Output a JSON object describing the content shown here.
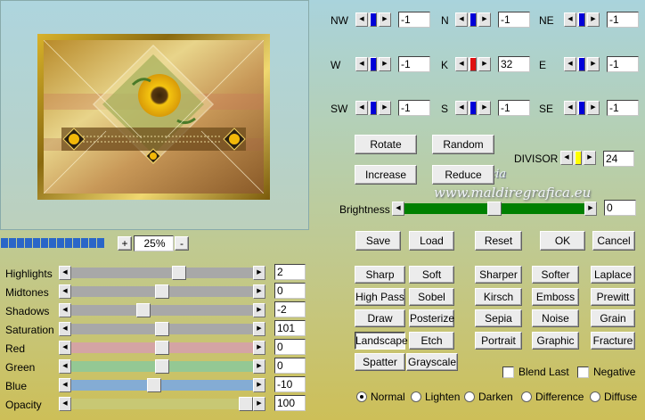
{
  "preview": {
    "zoom_value": "25%",
    "zoom_plus": "+",
    "zoom_minus": "-",
    "progress_segments": 13
  },
  "watermark": {
    "line1": "Pinuccia",
    "line2": "www.maldiregrafica.eu"
  },
  "matrix": [
    {
      "label": "NW",
      "value": "-1",
      "color": "#0000d8"
    },
    {
      "label": "N",
      "value": "-1",
      "color": "#0000d8"
    },
    {
      "label": "NE",
      "value": "-1",
      "color": "#0000d8"
    },
    {
      "label": "W",
      "value": "-1",
      "color": "#0000d8"
    },
    {
      "label": "K",
      "value": "32",
      "color": "#e01010"
    },
    {
      "label": "E",
      "value": "-1",
      "color": "#0000d8"
    },
    {
      "label": "SW",
      "value": "-1",
      "color": "#0000d8"
    },
    {
      "label": "S",
      "value": "-1",
      "color": "#0000d8"
    },
    {
      "label": "SE",
      "value": "-1",
      "color": "#0000d8"
    }
  ],
  "buttons": {
    "rotate": "Rotate",
    "random": "Random",
    "increase": "Increase",
    "reduce": "Reduce",
    "save": "Save",
    "load": "Load",
    "reset": "Reset",
    "ok": "OK",
    "cancel": "Cancel"
  },
  "divisor": {
    "label": "DIVISOR",
    "value": "24",
    "color": "#ffff00"
  },
  "brightness": {
    "label": "Brightness",
    "value": "0",
    "level": 0.5,
    "color": "#008000"
  },
  "adjustments": [
    {
      "label": "Highlights",
      "value": "2",
      "level": 0.6,
      "color": "#a8a8a8"
    },
    {
      "label": "Midtones",
      "value": "0",
      "level": 0.5,
      "color": "#a8a8a8"
    },
    {
      "label": "Shadows",
      "value": "-2",
      "level": 0.39,
      "color": "#a8a8a8"
    },
    {
      "label": "Saturation",
      "value": "101",
      "level": 0.5,
      "color": "#a8a8a8"
    },
    {
      "label": "Red",
      "value": "0",
      "level": 0.5,
      "color": "#d4a4a4"
    },
    {
      "label": "Green",
      "value": "0",
      "level": 0.5,
      "color": "#94c894"
    },
    {
      "label": "Blue",
      "value": "-10",
      "level": 0.45,
      "color": "#84acd4"
    },
    {
      "label": "Opacity",
      "value": "100",
      "level": 1.0,
      "color": "#c8c874"
    }
  ],
  "effects": [
    "Sharp",
    "Soft",
    "Sharper",
    "Softer",
    "Laplace",
    "High Pass",
    "Sobel",
    "Kirsch",
    "Emboss",
    "Prewitt",
    "Draw",
    "Posterize",
    "Sepia",
    "Noise",
    "Grain",
    "Landscape",
    "Etch",
    "Portrait",
    "Graphic",
    "Fracture",
    "Spatter",
    "Grayscale"
  ],
  "checkboxes": {
    "blend_last": "Blend Last",
    "negative": "Negative"
  },
  "blend_modes": [
    "Normal",
    "Lighten",
    "Darken",
    "Difference",
    "Diffuse"
  ],
  "blend_selected": "Normal"
}
